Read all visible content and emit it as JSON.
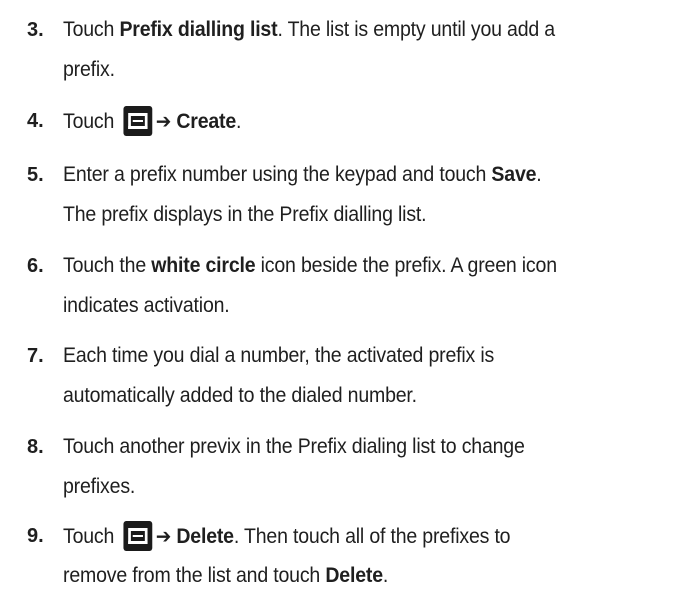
{
  "steps": [
    {
      "number": "3.",
      "lines": [
        {
          "t1": "Touch ",
          "b1": "Prefix dialling list",
          "t2": ". The list is empty until you add a"
        },
        {
          "t1": "prefix."
        }
      ]
    },
    {
      "number": "4.",
      "line": {
        "t1": "Touch ",
        "icon": "menu-icon",
        "arrow": "➔",
        "b1": "Create",
        "t2": "."
      }
    },
    {
      "number": "5.",
      "lines": [
        {
          "t1": "Enter a prefix number using the keypad and touch ",
          "b1": "Save",
          "t2": "."
        },
        {
          "t1": "The prefix displays in the Prefix dialling list."
        }
      ]
    },
    {
      "number": "6.",
      "lines": [
        {
          "t1": "Touch the ",
          "b1": "white circle",
          "t2": " icon beside the prefix. A green icon"
        },
        {
          "t1": "indicates activation."
        }
      ]
    },
    {
      "number": "7.",
      "lines": [
        {
          "t1": "Each time you dial a number, the activated prefix is"
        },
        {
          "t1": "automatically added to the dialed number."
        }
      ]
    },
    {
      "number": "8.",
      "lines": [
        {
          "t1": "Touch another previx in the Prefix dialing list to change"
        },
        {
          "t1": "prefixes."
        }
      ]
    },
    {
      "number": "9.",
      "lines": [
        {
          "t1": "Touch ",
          "icon": "menu-icon",
          "arrow": "➔",
          "b1": "Delete",
          "t2": ". Then touch all of the prefixes to"
        },
        {
          "t1": "remove from the list and touch ",
          "b1": "Delete",
          "t2": "."
        }
      ]
    }
  ]
}
